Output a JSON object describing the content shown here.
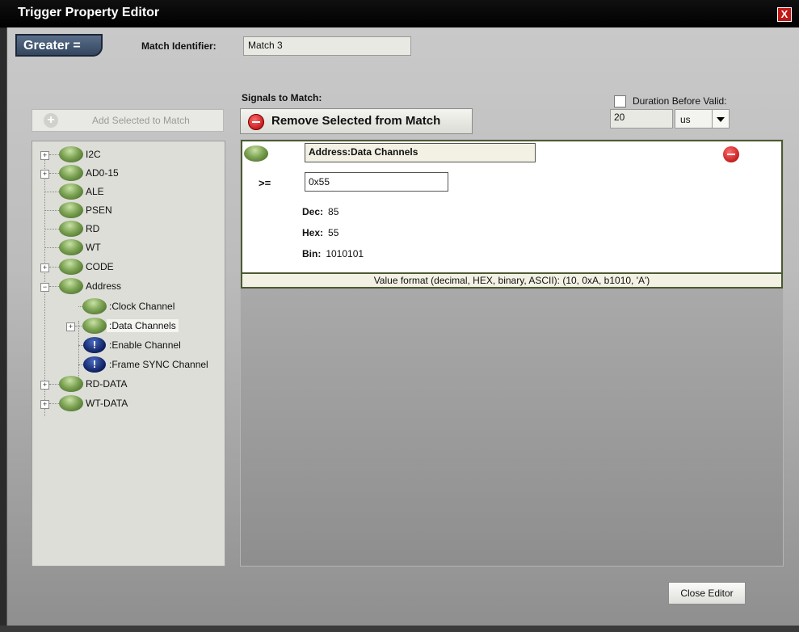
{
  "window": {
    "title": "Trigger Property Editor",
    "close_glyph": "X"
  },
  "mode": {
    "label": "Greater ="
  },
  "match_identifier": {
    "label": "Match Identifier:",
    "value": "Match 3"
  },
  "signals": {
    "label": "Signals to Match:"
  },
  "buttons": {
    "add": "Add Selected to Match",
    "remove": "Remove Selected from Match",
    "close": "Close Editor"
  },
  "duration": {
    "label": "Duration Before Valid:",
    "checked": false,
    "value": "20",
    "unit": "us"
  },
  "tree": {
    "items": [
      {
        "label": "I2C",
        "icon": "green-ball-icon",
        "expandable": true
      },
      {
        "label": "AD0-15",
        "icon": "green-ball-icon",
        "expandable": true
      },
      {
        "label": "ALE",
        "icon": "green-ball-icon",
        "expandable": false
      },
      {
        "label": "PSEN",
        "icon": "green-ball-icon",
        "expandable": false
      },
      {
        "label": "RD",
        "icon": "green-ball-icon",
        "expandable": false
      },
      {
        "label": "WT",
        "icon": "green-ball-icon",
        "expandable": false
      },
      {
        "label": "CODE",
        "icon": "green-ball-icon",
        "expandable": true
      },
      {
        "label": "Address",
        "icon": "green-ball-icon",
        "expanded": true
      },
      {
        "label": ":Clock Channel",
        "icon": "green-ball-icon",
        "child": true
      },
      {
        "label": ":Data Channels",
        "icon": "green-ball-icon",
        "child": true,
        "selected": true
      },
      {
        "label": ":Enable Channel",
        "icon": "warning-icon",
        "child": true
      },
      {
        "label": ":Frame SYNC Channel",
        "icon": "warning-icon",
        "child": true
      },
      {
        "label": "RD-DATA",
        "icon": "green-ball-icon",
        "expandable": true
      },
      {
        "label": "WT-DATA",
        "icon": "green-ball-icon",
        "expandable": true
      }
    ]
  },
  "match": {
    "signal": "Address:Data Channels",
    "operator": ">=",
    "value": "0x55",
    "dec_label": "Dec:",
    "dec": "85",
    "hex_label": "Hex:",
    "hex": "55",
    "bin_label": "Bin:",
    "bin": "1010101",
    "format_hint": "Value format (decimal, HEX, binary, ASCII): (10, 0xA, b1010, 'A')"
  },
  "colors": {
    "title_bar": "#000000",
    "card_border": "#4b5a32",
    "mode_tab": "#34465e",
    "remove_red": "#b00000"
  }
}
